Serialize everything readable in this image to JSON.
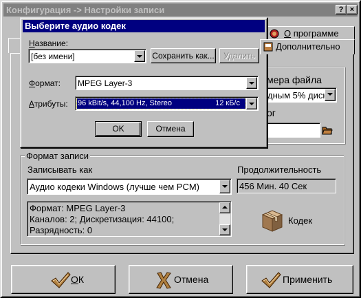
{
  "window": {
    "title": "Конфигурация -> Настройки записи",
    "help_btn": "?",
    "close_btn": "×"
  },
  "tabs": {
    "about_prefix": "О",
    "about_rest": " программе",
    "extra_prefix": "Д",
    "extra_rest": "ополнительно"
  },
  "background_panel": {
    "filesize_label": "мера файла",
    "filesize_value": "дным 5% диск",
    "catalog_label": "ог"
  },
  "record_format": {
    "group_title": "Формат записи",
    "record_as_label": "Записывать как",
    "record_as_value": "Аудио кодеки Windows (лучше чем PCM)",
    "duration_label": "Продолжительность",
    "duration_value": "456 Мин. 40 Сек",
    "info_lines": [
      "Формат: MPEG Layer-3",
      "Каналов: 2; Дискретизация: 44100;",
      "Разрядность: 0"
    ],
    "codec_button": "Кодек"
  },
  "bottom_buttons": {
    "ok_prefix": "О",
    "ok_rest": "К",
    "cancel": "Отмена",
    "apply": "Применить"
  },
  "codec_dialog": {
    "title": "Выберите аудио кодек",
    "name_label_prefix": "Н",
    "name_label_rest": "азвание:",
    "name_value": "[без имени]",
    "save_as": "Сохранить как...",
    "delete": "Удалить",
    "format_label_prefix": "Ф",
    "format_label_rest": "ормат:",
    "format_value": "MPEG Layer-3",
    "attributes_label_prefix": "А",
    "attributes_label_rest": "трибуты:",
    "attributes_value": "96 kBit/s, 44,100 Hz, Stereo",
    "attributes_rate": "12 кБ/с",
    "ok": "OK",
    "cancel": "Отмена"
  },
  "colors": {
    "face": "#c0c0c0",
    "titlebar_active": "#000080",
    "titlebar_inactive": "#808080",
    "selection": "#000080"
  }
}
